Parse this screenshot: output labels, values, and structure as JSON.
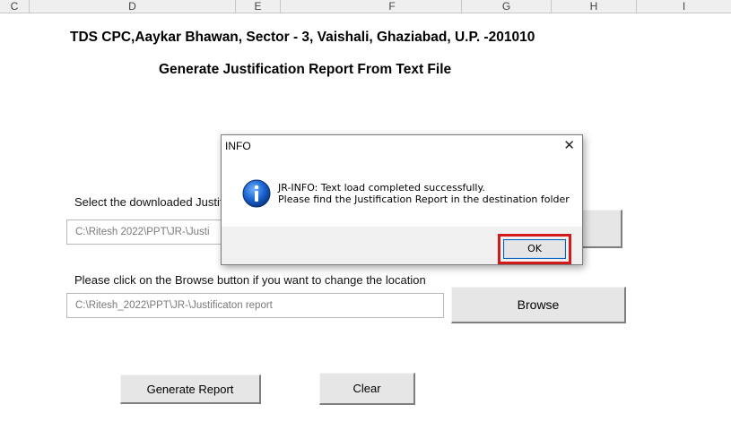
{
  "columns": [
    "C",
    "D",
    "E",
    "F",
    "G",
    "H",
    "I"
  ],
  "header": {
    "address": "TDS CPC,Aaykar Bhawan, Sector - 3, Vaishali, Ghaziabad, U.P. -201010",
    "title": "Generate Justification Report From Text File"
  },
  "form": {
    "select_label": "Select the downloaded Justif",
    "source_path": "C:\\Ritesh  2022\\PPT\\JR-\\Justi",
    "browse_hint": "Please click on the Browse button if you want to change the location",
    "dest_path": "C:\\Ritesh_2022\\PPT\\JR-\\Justificaton report",
    "browse_label": "Browse",
    "generate_label": "Generate Report",
    "clear_label": "Clear"
  },
  "dialog": {
    "title": "INFO",
    "close_glyph": "✕",
    "icon": "info-icon",
    "line1": "JR-INFO: Text load completed successfully.",
    "line2": "Please find the Justification Report in the destination folder",
    "ok_label": "OK",
    "highlight_color": "#d31a1a"
  }
}
